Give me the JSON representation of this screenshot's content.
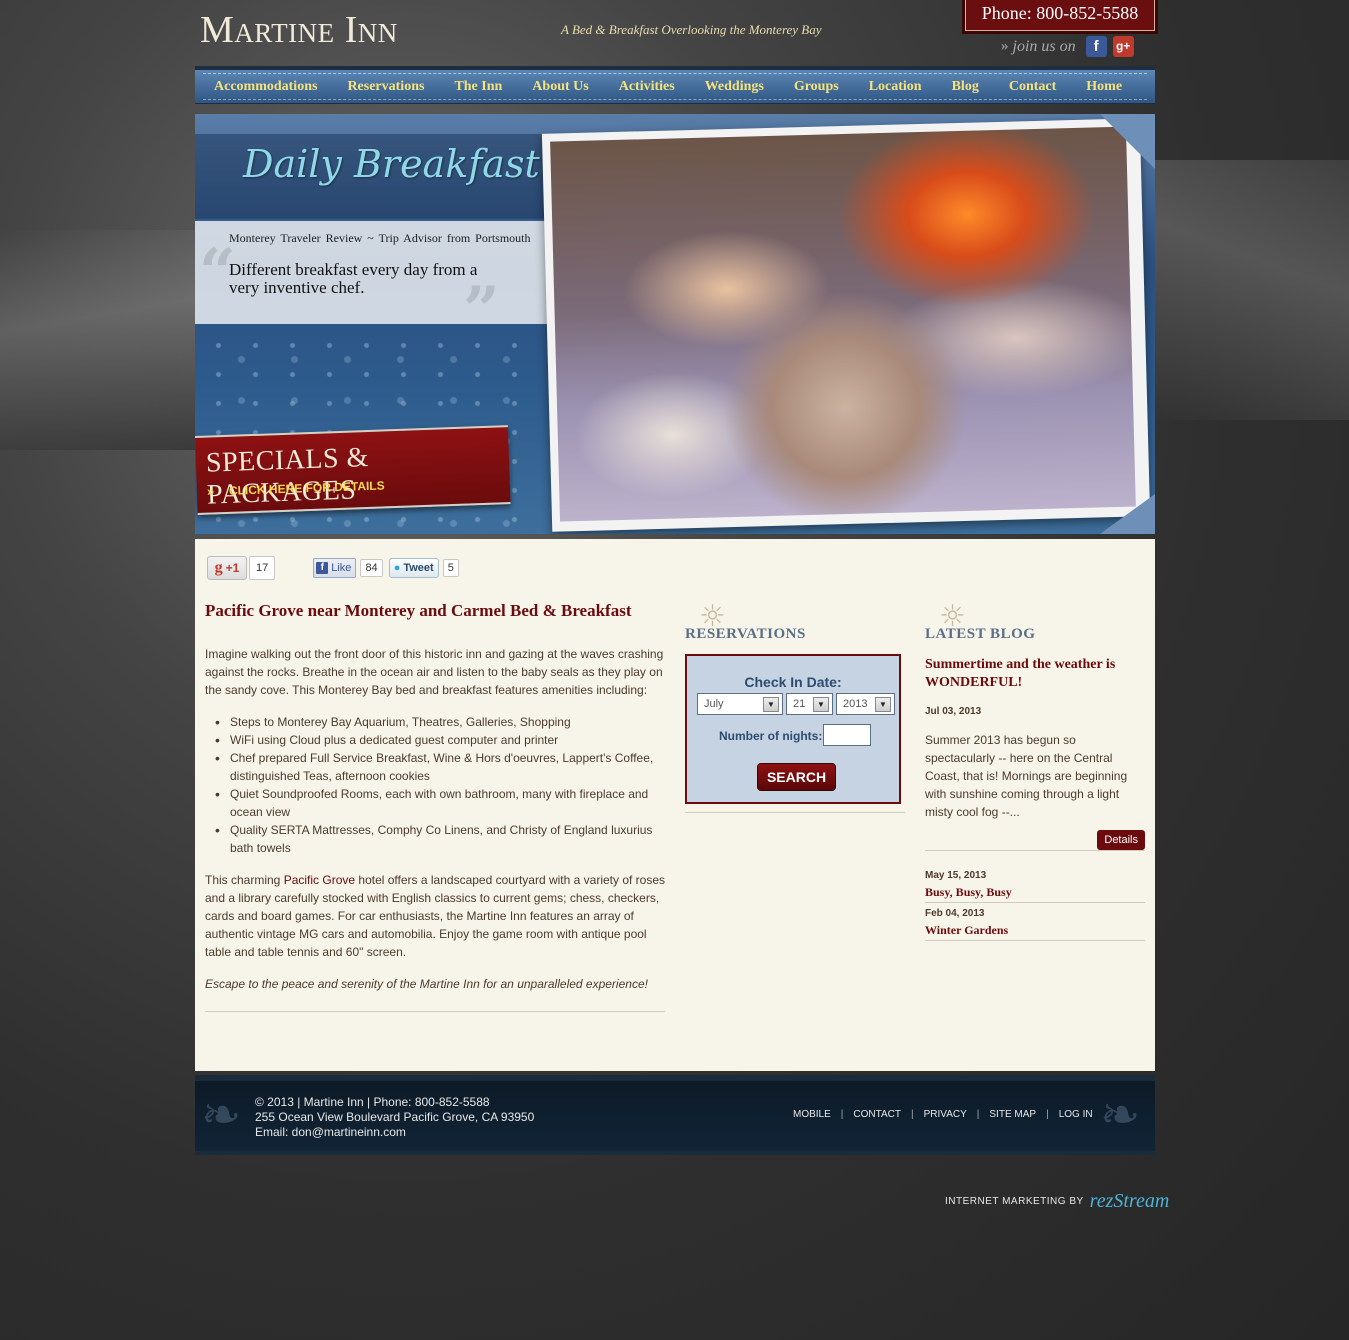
{
  "header": {
    "logo": "Martine Inn",
    "tagline": "A Bed & Breakfast Overlooking the Monterey Bay",
    "phone": "Phone: 800-852-5588",
    "join_label": "join us on",
    "join_arrows": "»",
    "facebook_glyph": "f",
    "gplus_glyph": "g+"
  },
  "nav": [
    "Accommodations",
    "Reservations",
    "The Inn",
    "About Us",
    "Activities",
    "Weddings",
    "Groups",
    "Location",
    "Blog",
    "Contact",
    "Home"
  ],
  "banner": {
    "title": "Daily Breakfast",
    "quote_source": "Monterey Traveler Review ~ Trip Advisor from Portsmouth",
    "quote_text": "Different breakfast every day from a very inventive chef.",
    "specials_title": "SPECIALS & PACKAGES",
    "specials_cta": "CLICK HERE FOR DETAILS",
    "specials_arrow": "»"
  },
  "share": {
    "gplus_label": "+1",
    "gplus_glyph": "g",
    "gplus_count": "17",
    "fb_label": "Like",
    "fb_glyph": "f",
    "fb_count": "84",
    "tweet_label": "Tweet",
    "tweet_count": "5"
  },
  "main": {
    "title": "Pacific Grove near Monterey and Carmel Bed & Breakfast",
    "intro": "Imagine walking out the front door of this historic inn and gazing at the waves crashing against the rocks. Breathe in the ocean air and listen to the baby seals as they play on the sandy cove. This Monterey Bay bed and breakfast features amenities including:",
    "amenities": [
      "Steps to Monterey Bay Aquarium, Theatres, Galleries, Shopping",
      "WiFi using Cloud plus a dedicated guest computer and printer",
      "Chef prepared Full Service Breakfast, Wine & Hors d'oeuvres, Lappert's Coffee, distinguished Teas, afternoon cookies",
      "Quiet Soundproofed Rooms, each with own bathroom, many with fireplace and ocean view",
      "Quality SERTA Mattresses, Comphy Co Linens, and Christy of England luxurius bath towels"
    ],
    "para2_before": "This  charming ",
    "para2_link": "Pacific Grove",
    "para2_after": " hotel offers a landscaped courtyard with a variety of roses and a library carefully stocked with English classics to current gems; chess, checkers, cards and board games. For car enthusiasts, the Martine Inn features an array of authentic vintage MG cars and automobilia. Enjoy the game room with antique pool table and table tennis and 60\" screen.",
    "escape": "Escape to the peace and serenity of the Martine Inn for an unparalleled experience!"
  },
  "reservations": {
    "heading": "RESERVATIONS",
    "checkin_label": "Check In Date:",
    "month": "July",
    "day": "21",
    "year": "2013",
    "dropdown_glyph": "▼",
    "nights_label": "Number of nights:",
    "nights_value": "",
    "search_label": "SEARCH"
  },
  "blog": {
    "heading": "LATEST BLOG",
    "featured_title": "Summertime and the weather is WONDERFUL!",
    "featured_date": "Jul 03, 2013",
    "featured_excerpt": "Summer 2013 has begun so spectacularly -- here on the Central Coast, that is!  Mornings are beginning with sunshine coming through a light misty cool fog --...",
    "details_label": "Details",
    "items": [
      {
        "date": "May 15, 2013",
        "title": "Busy, Busy, Busy"
      },
      {
        "date": "Feb 04, 2013",
        "title": "Winter Gardens"
      }
    ]
  },
  "footer": {
    "line1": "© 2013 | Martine Inn | Phone: 800-852-5588",
    "line2": "255 Ocean View Boulevard Pacific Grove, CA 93950",
    "line3": "Email: don@martineinn.com",
    "links": [
      "MOBILE",
      "CONTACT",
      "PRIVACY",
      "SITE MAP",
      "LOG IN"
    ],
    "separator": "|",
    "marketing_label": "INTERNET MARKETING BY",
    "marketing_brand": "rezStream"
  },
  "colors": {
    "accent": "#6b0b0d",
    "nav_text": "#f5e27a",
    "nav_bg": "#3e6a99",
    "content_bg": "#f7f5ea"
  },
  "icons": [
    "facebook-icon",
    "google-plus-icon",
    "dropdown-arrow-icon",
    "twitter-bird-icon",
    "quote-mark-icon",
    "swirl-ornament-icon"
  ]
}
